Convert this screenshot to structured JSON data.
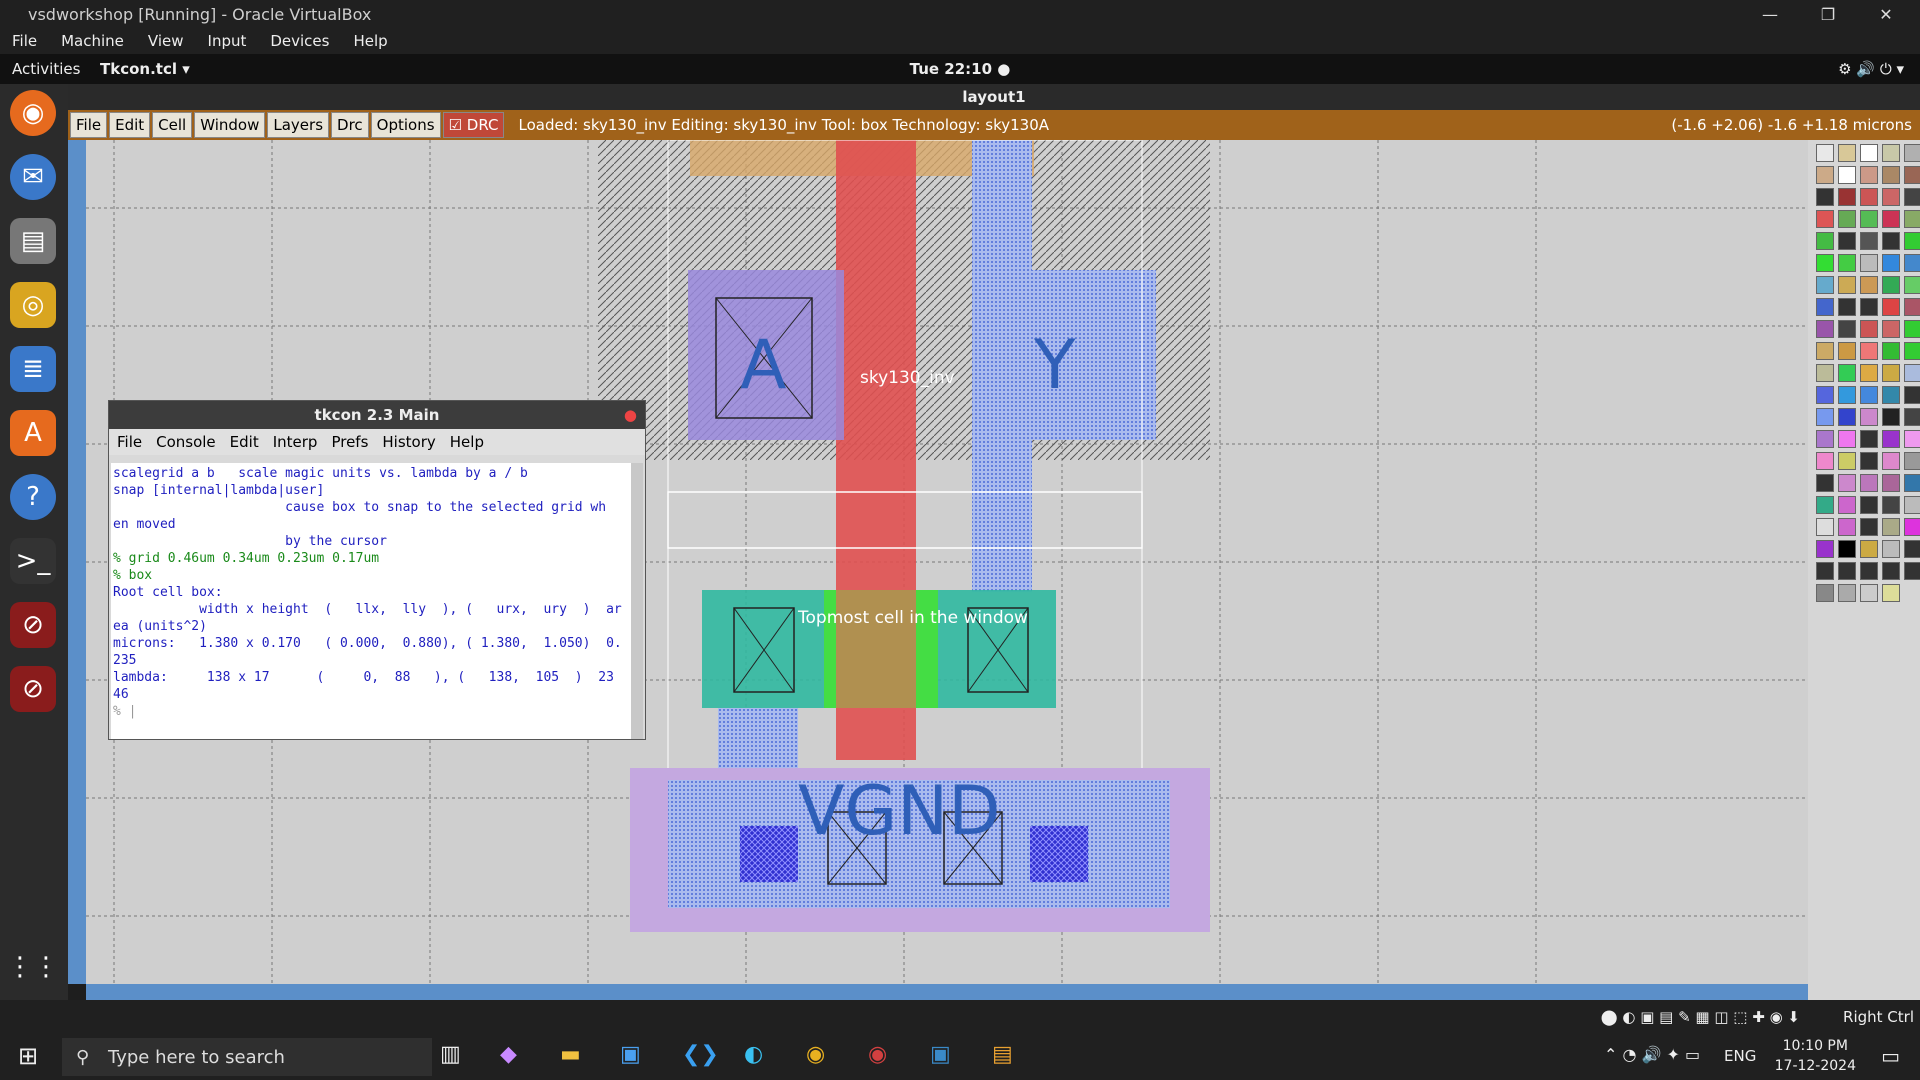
{
  "virtualbox": {
    "title": "vsdworkshop [Running] - Oracle VirtualBox",
    "menu": [
      "File",
      "Machine",
      "View",
      "Input",
      "Devices",
      "Help"
    ],
    "host_key": "Right Ctrl"
  },
  "gnome": {
    "activities": "Activities",
    "app_menu": "Tkcon.tcl ▾",
    "clock": "Tue 22:10 ●"
  },
  "magic": {
    "window_title": "layout1",
    "toolbar": [
      "File",
      "Edit",
      "Cell",
      "Window",
      "Layers",
      "Drc",
      "Options"
    ],
    "drc_label": "DRC",
    "status": "Loaded: sky130_inv Editing: sky130_inv Tool: box  Technology: sky130A",
    "coords": "(-1.6 +2.06) -1.6 +1.18 microns",
    "labels": {
      "cell_name": "sky130_inv",
      "pin_a": "A",
      "pin_y": "Y",
      "vgnd": "VGND",
      "topmost": "Topmost cell in the window"
    }
  },
  "tkcon": {
    "title": "tkcon 2.3 Main",
    "menu": [
      "File",
      "Console",
      "Edit",
      "Interp",
      "Prefs",
      "History",
      "Help"
    ],
    "lines": [
      "scalegrid a b   scale magic units vs. lambda by a / b",
      "snap [internal|lambda|user]",
      "                      cause box to snap to the selected grid wh",
      "en moved",
      "                      by the cursor",
      "% grid 0.46um 0.34um 0.23um 0.17um",
      "% box",
      "Root cell box:",
      "           width x height  (   llx,  lly  ), (   urx,  ury  )  ar",
      "ea (units^2)",
      "",
      "microns:   1.380 x 0.170   ( 0.000,  0.880), ( 1.380,  1.050)  0.",
      "235",
      "lambda:     138 x 17      (     0,  88   ), (   138,  105  )  23",
      "46",
      "% |"
    ]
  },
  "taskbar": {
    "search_placeholder": "Type here to search",
    "lang": "ENG",
    "time": "10:10 PM",
    "date": "17-12-2024"
  }
}
